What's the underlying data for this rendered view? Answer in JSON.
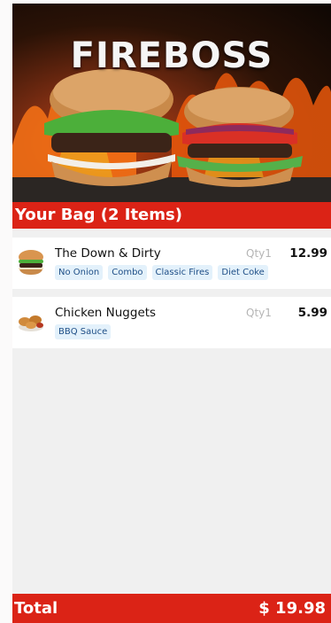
{
  "hero": {
    "brand": "FIREBOSS"
  },
  "bag": {
    "title": "Your Bag (2 Items)"
  },
  "items": [
    {
      "name": "The Down & Dirty",
      "qty": "Qty1",
      "price": "12.99",
      "icon": "burger-icon",
      "tags": [
        "No Onion",
        "Combo",
        "Classic Fires",
        "Diet Coke"
      ]
    },
    {
      "name": "Chicken Nuggets",
      "qty": "Qty1",
      "price": "5.99",
      "icon": "nuggets-icon",
      "tags": [
        "BBQ Sauce"
      ]
    }
  ],
  "total": {
    "label": "Total",
    "value": "$ 19.98"
  },
  "colors": {
    "accent": "#db2316",
    "tag_bg": "#e3f1fb",
    "tag_text": "#1f4f87"
  }
}
